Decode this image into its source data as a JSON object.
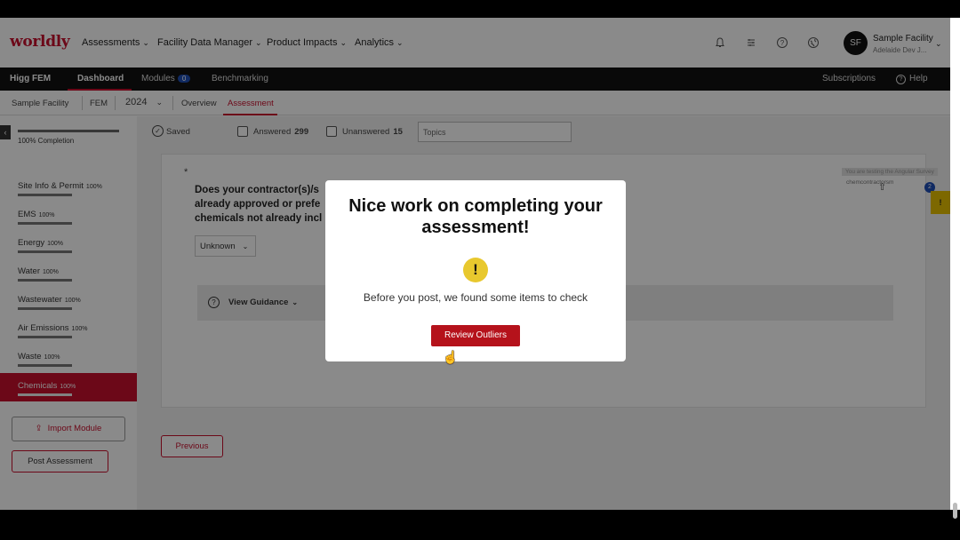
{
  "topnav": {
    "logo": "worldly",
    "menus": [
      "Assessments",
      "Facility Data Manager",
      "Product Impacts",
      "Analytics"
    ],
    "icons": [
      "bell-icon",
      "list-icon",
      "help-icon",
      "globe-icon"
    ],
    "avatar": "SF",
    "facility_name": "Sample Facility",
    "facility_sub": "Adelaide Dev J..."
  },
  "blackbar": {
    "brand": "Higg FEM",
    "tabs": [
      "Dashboard",
      "Modules",
      "Benchmarking"
    ],
    "modules_badge": "0",
    "subscriptions": "Subscriptions",
    "help": "Help"
  },
  "subnav": {
    "facility": "Sample Facility",
    "module": "FEM",
    "year": "2024",
    "tabs": [
      "Overview",
      "Assessment"
    ]
  },
  "sidebar": {
    "completion": "100% Completion",
    "items": [
      {
        "label": "Site Info & Permit",
        "pct": "100%"
      },
      {
        "label": "EMS",
        "pct": "100%"
      },
      {
        "label": "Energy",
        "pct": "100%"
      },
      {
        "label": "Water",
        "pct": "100%"
      },
      {
        "label": "Wastewater",
        "pct": "100%"
      },
      {
        "label": "Air Emissions",
        "pct": "100%"
      },
      {
        "label": "Waste",
        "pct": "100%"
      },
      {
        "label": "Chemicals",
        "pct": "100%"
      }
    ],
    "import_label": "Import Module",
    "post_label": "Post Assessment"
  },
  "toolbar": {
    "saved": "Saved",
    "answered_label": "Answered",
    "answered_count": "299",
    "unanswered_label": "Unanswered",
    "unanswered_count": "15",
    "topics_placeholder": "Topics"
  },
  "question": {
    "asterisk": "*",
    "line1": "Does your contractor(s)/s",
    "line2": "already approved or prefe",
    "line3": "chemicals not already incl",
    "answer": "Unknown",
    "guidance": "View Guidance",
    "note": "You are testing the Angular Survey",
    "note2": "chemcontractorsm",
    "badge": "2",
    "flag": "!"
  },
  "previous_label": "Previous",
  "modal": {
    "title": "Nice work on completing your assessment!",
    "warn": "!",
    "message": "Before you post, we found some items to check",
    "button": "Review Outliers"
  }
}
